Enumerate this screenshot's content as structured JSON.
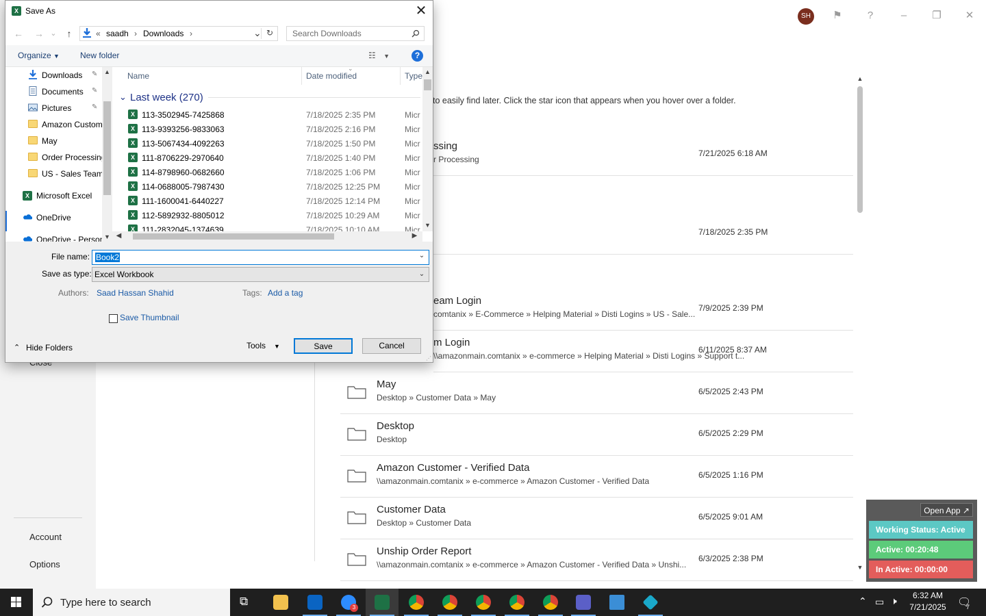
{
  "dialog": {
    "title": "Save As",
    "nav": {
      "back": "←",
      "forward": "→",
      "recent": "⌄",
      "up": "↑",
      "refresh": "↻"
    },
    "address": {
      "overflow": "«",
      "crumbs": [
        "saadh",
        "Downloads"
      ]
    },
    "search_placeholder": "Search Downloads",
    "toolbar": {
      "organize": "Organize",
      "new_folder": "New folder",
      "help": "?"
    },
    "nav_pane": [
      {
        "label": "Downloads",
        "icon": "download-arrow-icon",
        "pinned": true
      },
      {
        "label": "Documents",
        "icon": "documents-icon",
        "pinned": true
      },
      {
        "label": "Pictures",
        "icon": "pictures-icon",
        "pinned": true
      },
      {
        "label": "Amazon Custom",
        "icon": "folder-icon",
        "pinned": false
      },
      {
        "label": "May",
        "icon": "folder-icon",
        "pinned": false
      },
      {
        "label": "Order Processing",
        "icon": "folder-icon",
        "pinned": false
      },
      {
        "label": "US - Sales Team",
        "icon": "folder-icon",
        "pinned": false
      },
      {
        "label": "Microsoft Excel",
        "icon": "excel-icon",
        "pinned": false
      },
      {
        "label": "OneDrive",
        "icon": "onedrive-icon",
        "pinned": false
      },
      {
        "label": "OneDrive - Person",
        "icon": "onedrive-icon",
        "pinned": false
      }
    ],
    "columns": {
      "name": "Name",
      "date": "Date modified",
      "type": "Type"
    },
    "group_header": "Last week (270)",
    "files": [
      {
        "name": "113-3502945-7425868",
        "date": "7/18/2025 2:35 PM",
        "type": "Micr"
      },
      {
        "name": "113-9393256-9833063",
        "date": "7/18/2025 2:16 PM",
        "type": "Micr"
      },
      {
        "name": "113-5067434-4092263",
        "date": "7/18/2025 1:50 PM",
        "type": "Micr"
      },
      {
        "name": "111-8706229-2970640",
        "date": "7/18/2025 1:40 PM",
        "type": "Micr"
      },
      {
        "name": "114-8798960-0682660",
        "date": "7/18/2025 1:06 PM",
        "type": "Micr"
      },
      {
        "name": "114-0688005-7987430",
        "date": "7/18/2025 12:25 PM",
        "type": "Micr"
      },
      {
        "name": "111-1600041-6440227",
        "date": "7/18/2025 12:14 PM",
        "type": "Micr"
      },
      {
        "name": "112-5892932-8805012",
        "date": "7/18/2025 10:29 AM",
        "type": "Micr"
      },
      {
        "name": "111-2832045-1374639",
        "date": "7/18/2025 10:10 AM",
        "type": "Micr"
      }
    ],
    "filename_label": "File name:",
    "filename_value": "Book2",
    "savetype_label": "Save as type:",
    "savetype_value": "Excel Workbook",
    "authors_label": "Authors:",
    "authors_value": "Saad Hassan Shahid",
    "tags_label": "Tags:",
    "tags_value": "Add a tag",
    "save_thumbnail": "Save Thumbnail",
    "hide_folders": "Hide Folders",
    "tools": "Tools",
    "save": "Save",
    "cancel": "Cancel",
    "close": "✕"
  },
  "backstage": {
    "left_nav": {
      "close": "Close",
      "account": "Account",
      "options": "Options"
    },
    "avatar_initials": "SH",
    "hint": "to easily find later. Click the star icon that appears when you hover over a folder.",
    "folders": [
      {
        "name": "ssing",
        "path": "r Processing",
        "date": "7/21/2025 6:18 AM",
        "icon": false
      },
      {
        "name": "",
        "path": "",
        "date": "7/18/2025 2:35 PM",
        "icon": false
      },
      {
        "name": "eam Login",
        "path": "comtanix » E-Commerce » Helping Material » Disti Logins » US - Sale...",
        "date": "7/9/2025 2:39 PM",
        "icon": false
      },
      {
        "name": "m Login",
        "path": "\\\\amazonmain.comtanix » e-commerce » Helping Material » Disti Logins » Support t...",
        "date": "6/11/2025 8:37 AM",
        "icon": false
      },
      {
        "name": "May",
        "path": "Desktop » Customer Data » May",
        "date": "6/5/2025 2:43 PM",
        "icon": true
      },
      {
        "name": "Desktop",
        "path": "Desktop",
        "date": "6/5/2025 2:29 PM",
        "icon": true
      },
      {
        "name": "Amazon Customer - Verified Data",
        "path": "\\\\amazonmain.comtanix » e-commerce » Amazon Customer - Verified Data",
        "date": "6/5/2025 1:16 PM",
        "icon": true
      },
      {
        "name": "Customer Data",
        "path": "Desktop » Customer Data",
        "date": "6/5/2025 9:01 AM",
        "icon": true
      },
      {
        "name": "Unship Order Report",
        "path": "\\\\amazonmain.comtanix » e-commerce » Amazon Customer - Verified Data » Unshi...",
        "date": "6/3/2025 2:38 PM",
        "icon": true
      }
    ]
  },
  "status_widget": {
    "open_app": "Open App ↗",
    "working_status": "Working Status: Active",
    "active": "Active: 00:20:48",
    "inactive": "In Active: 00:00:00",
    "colors": {
      "status": "#5cc8c4",
      "active": "#5ccb7a",
      "inactive": "#e35d5b"
    }
  },
  "taskbar": {
    "search_placeholder": "Type here to search",
    "zoom_badge": "3",
    "time": "6:32 AM",
    "date": "7/21/2025",
    "notification_count": "7"
  }
}
